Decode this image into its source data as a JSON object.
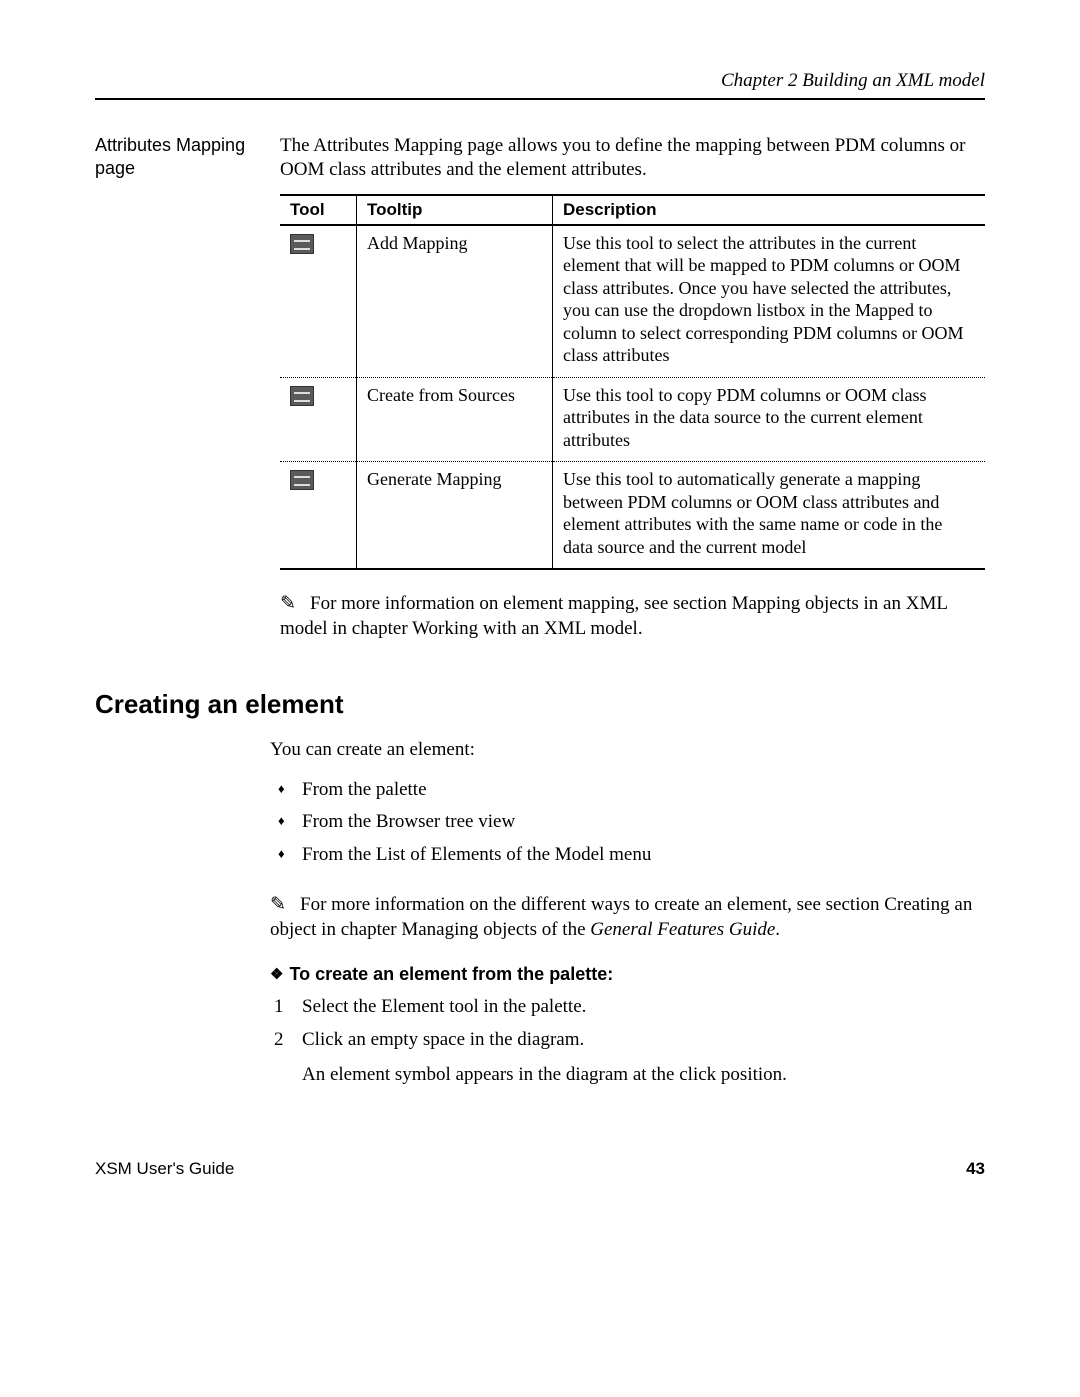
{
  "header": {
    "chapter": "Chapter 2  Building an XML model"
  },
  "attr_map": {
    "margin_label": "Attributes Mapping page",
    "intro": "The Attributes Mapping page allows you to define the mapping between PDM columns or OOM class attributes and the element attributes.",
    "headers": {
      "tool": "Tool",
      "tooltip": "Tooltip",
      "desc": "Description"
    },
    "rows": [
      {
        "icon": "add-mapping-icon",
        "tooltip": "Add Mapping",
        "desc": "Use this tool to select the attributes in the current element that will be mapped to PDM columns or OOM class attributes. Once you have selected the attributes, you can use the dropdown listbox in the Mapped to column to select corresponding PDM columns or OOM class attributes"
      },
      {
        "icon": "create-from-sources-icon",
        "tooltip": "Create from Sources",
        "desc": "Use this tool to copy PDM columns or OOM class attributes in the data source to the current element attributes"
      },
      {
        "icon": "generate-mapping-icon",
        "tooltip": "Generate Mapping",
        "desc": "Use this tool to automatically generate a mapping between PDM columns or OOM class attributes and element attributes with the same name or code in the data source and the current model"
      }
    ],
    "note": "For more information on element mapping, see section Mapping objects in an XML model in chapter Working with an XML model."
  },
  "creating": {
    "heading": "Creating an element",
    "intro": "You can create an element:",
    "bullets": [
      "From the palette",
      "From the Browser tree view",
      "From the List of Elements of the Model menu"
    ],
    "note_lead": "For more information on the different ways to create an element, see section Creating an object in chapter Managing objects of the ",
    "note_ital": "General Features Guide",
    "note_tail": ".",
    "proc_heading": "To create an element from the palette:",
    "steps": [
      "Select the Element tool in the palette.",
      "Click an empty space in the diagram."
    ],
    "after_steps": "An element symbol appears in the diagram at the click position."
  },
  "footer": {
    "guide": "XSM User's Guide",
    "page": "43"
  }
}
